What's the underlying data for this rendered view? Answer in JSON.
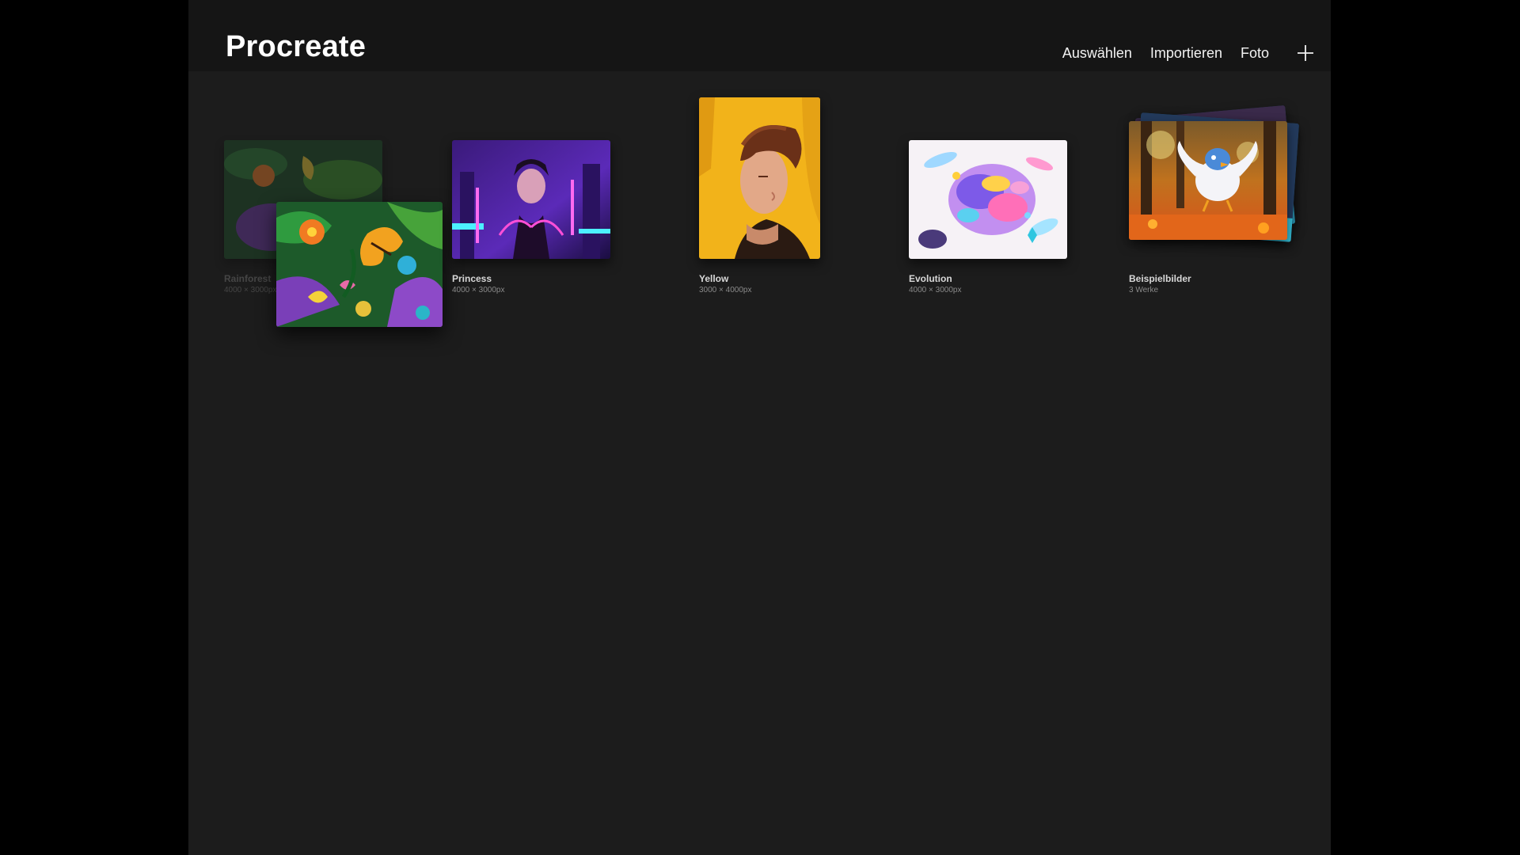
{
  "header": {
    "app_title": "Procreate",
    "nav": {
      "select_label": "Auswählen",
      "import_label": "Importieren",
      "photo_label": "Foto"
    },
    "add_icon": "plus-icon"
  },
  "gallery": {
    "items": [
      {
        "title": "Rainforest",
        "subtitle": "4000 × 3000px",
        "state": "being-dragged"
      },
      {
        "title": "Princess",
        "subtitle": "4000 × 3000px"
      },
      {
        "title": "Yellow",
        "subtitle": "3000 × 4000px"
      },
      {
        "title": "Evolution",
        "subtitle": "4000 × 3000px"
      },
      {
        "title": "Beispielbilder",
        "subtitle": "3 Werke",
        "type": "stack"
      }
    ]
  },
  "colors": {
    "background": "#1c1c1c",
    "header": "#151515",
    "outer": "#000000",
    "text": "#ffffff"
  }
}
